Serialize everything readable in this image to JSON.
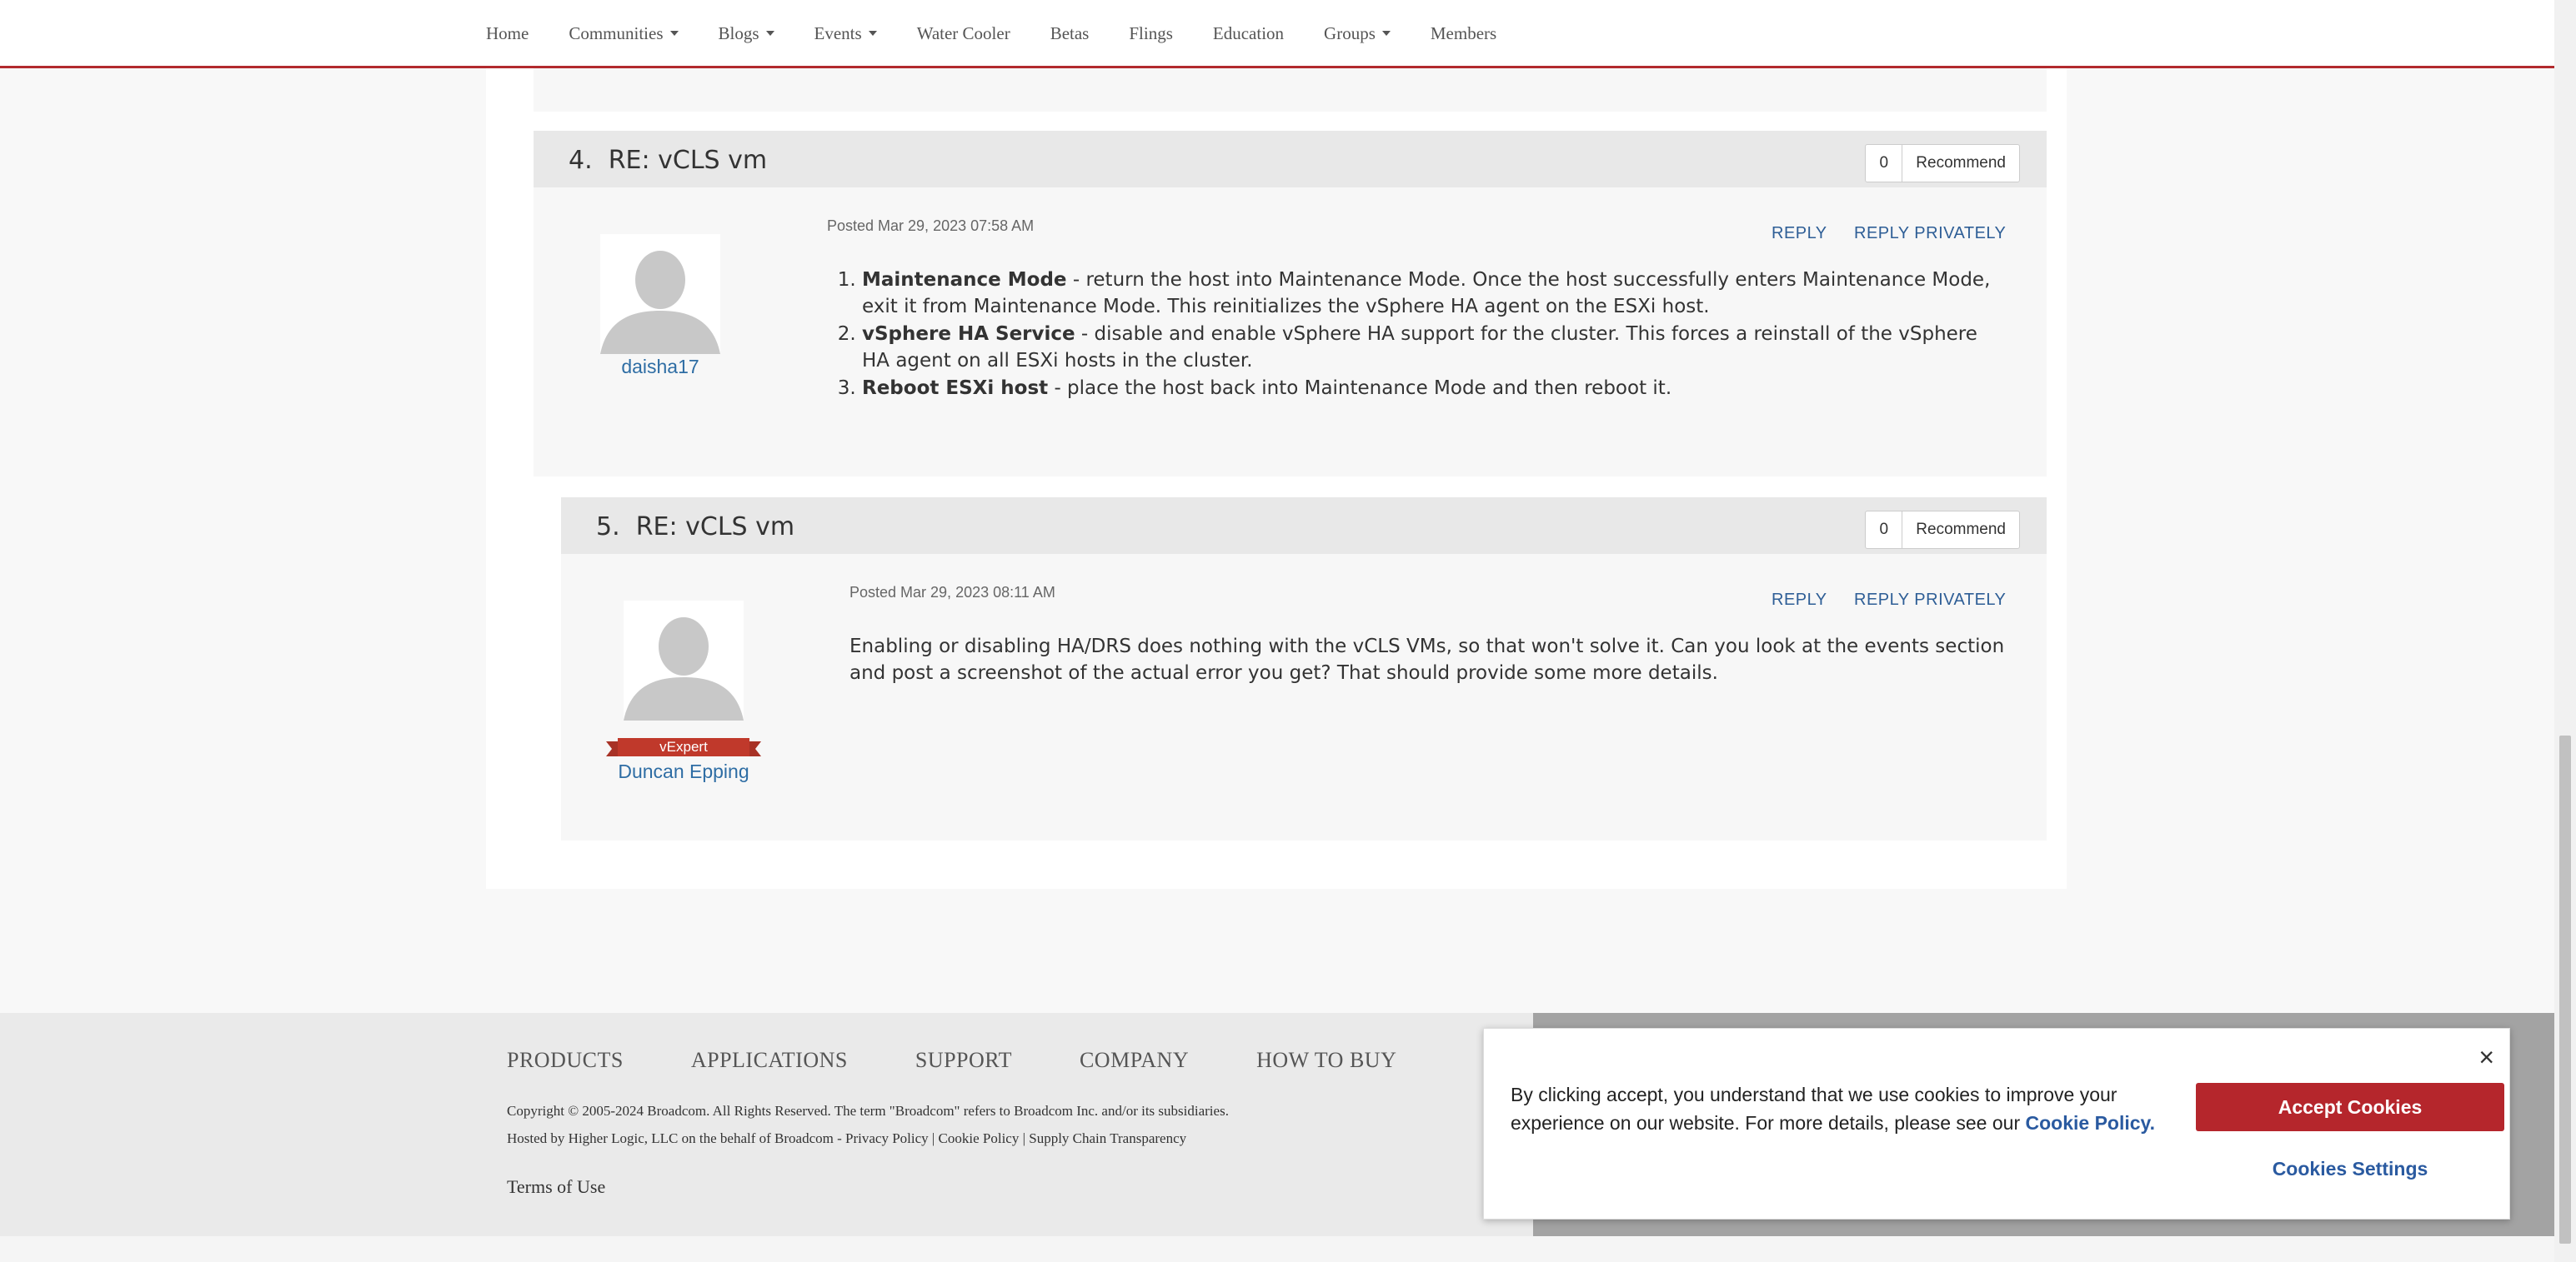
{
  "nav": {
    "items": [
      {
        "label": "Home",
        "dropdown": false
      },
      {
        "label": "Communities",
        "dropdown": true
      },
      {
        "label": "Blogs",
        "dropdown": true
      },
      {
        "label": "Events",
        "dropdown": true
      },
      {
        "label": "Water Cooler",
        "dropdown": false
      },
      {
        "label": "Betas",
        "dropdown": false
      },
      {
        "label": "Flings",
        "dropdown": false
      },
      {
        "label": "Education",
        "dropdown": false
      },
      {
        "label": "Groups",
        "dropdown": true
      },
      {
        "label": "Members",
        "dropdown": false
      }
    ]
  },
  "posts": [
    {
      "number": "4.",
      "title": "RE: vCLS vm",
      "recommend_count": "0",
      "recommend_label": "Recommend",
      "author": "daisha17",
      "posted": "Posted Mar 29, 2023 07:58 AM",
      "reply_label": "REPLY",
      "reply_privately_label": "REPLY PRIVATELY",
      "items": [
        {
          "bold": "Maintenance Mode",
          "text": " - return the host into Maintenance Mode. Once the host successfully enters Maintenance Mode, exit it from Maintenance Mode. This reinitializes the vSphere HA agent on the ESXi host."
        },
        {
          "bold": "vSphere HA Service",
          "text": " - disable and enable vSphere HA support for the cluster. This forces a reinstall of the vSphere HA agent on all ESXi hosts in the cluster."
        },
        {
          "bold": "Reboot ESXi host",
          "text": " - place the host back into Maintenance Mode and then reboot it."
        }
      ]
    },
    {
      "number": "5.",
      "title": "RE: vCLS vm",
      "recommend_count": "0",
      "recommend_label": "Recommend",
      "author": "Duncan Epping",
      "badge": "vExpert",
      "posted": "Posted Mar 29, 2023 08:11 AM",
      "reply_label": "REPLY",
      "reply_privately_label": "REPLY PRIVATELY",
      "body": "Enabling or disabling HA/DRS does nothing with the vCLS VMs, so that won't solve it. Can you look at the events section and post a screenshot of the actual error you get? That should provide some more details."
    }
  ],
  "footer": {
    "nav": [
      "PRODUCTS",
      "APPLICATIONS",
      "SUPPORT",
      "COMPANY",
      "HOW TO BUY"
    ],
    "copyright": "Copyright © 2005-2024 Broadcom. All Rights Reserved. The term \"Broadcom\" refers to Broadcom Inc. and/or its subsidiaries.",
    "hosted": "Hosted by Higher Logic, LLC on the behalf of Broadcom - Privacy Policy | Cookie Policy | Supply Chain Transparency",
    "terms": "Terms of Use"
  },
  "cookie": {
    "text": "By clicking accept, you understand that we use cookies to improve your experience on our website. For more details, please see our ",
    "link": "Cookie Policy.",
    "accept": "Accept Cookies",
    "settings": "Cookies Settings",
    "close": "×"
  }
}
